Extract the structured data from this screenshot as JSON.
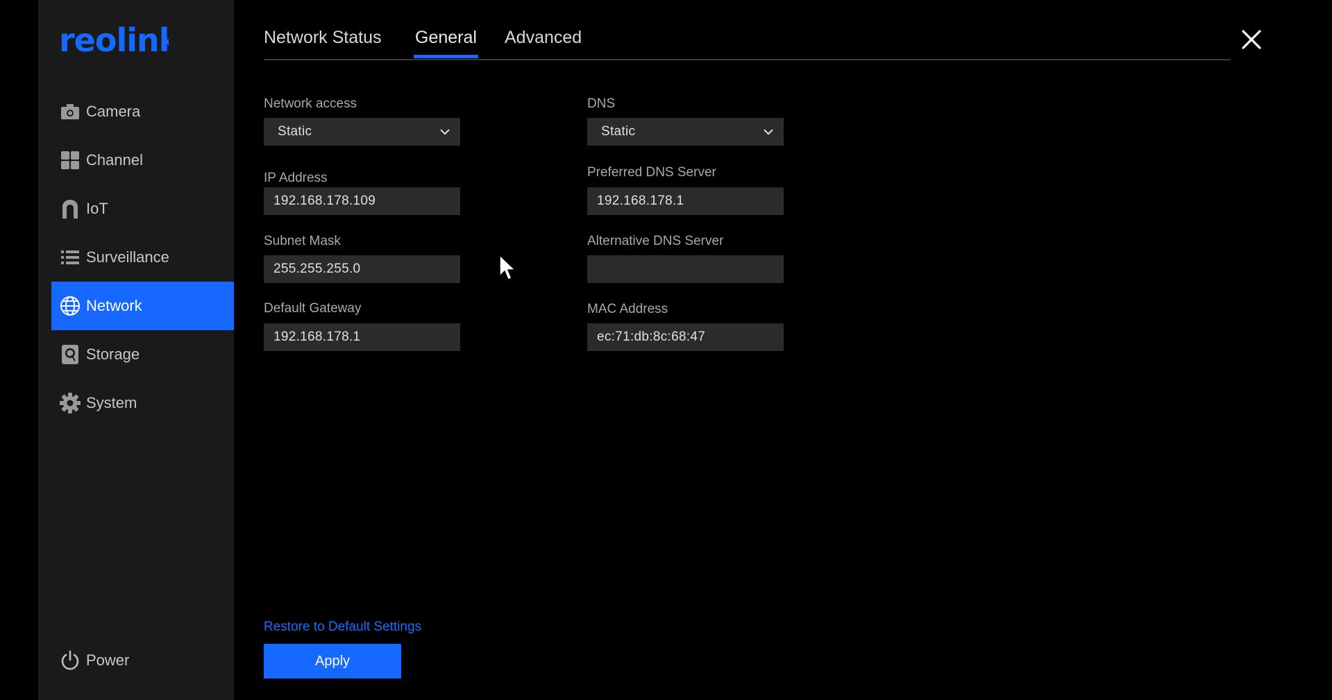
{
  "brand": {
    "name": "reolink",
    "color": "#1668ff"
  },
  "sidebar": {
    "items": [
      {
        "label": "Camera",
        "icon": "camera-icon"
      },
      {
        "label": "Channel",
        "icon": "grid-icon"
      },
      {
        "label": "IoT",
        "icon": "home-icon"
      },
      {
        "label": "Surveillance",
        "icon": "list-icon"
      },
      {
        "label": "Network",
        "icon": "globe-icon",
        "active": true
      },
      {
        "label": "Storage",
        "icon": "storage-icon"
      },
      {
        "label": "System",
        "icon": "gear-icon"
      }
    ],
    "power_label": "Power"
  },
  "tabs": [
    {
      "label": "Network Status"
    },
    {
      "label": "General",
      "active": true
    },
    {
      "label": "Advanced"
    }
  ],
  "form": {
    "network_access": {
      "label": "Network access",
      "value": "Static"
    },
    "ip_address": {
      "label": "IP Address",
      "value": "192.168.178.109"
    },
    "subnet_mask": {
      "label": "Subnet Mask",
      "value": "255.255.255.0"
    },
    "default_gateway": {
      "label": "Default Gateway",
      "value": "192.168.178.1"
    },
    "dns": {
      "label": "DNS",
      "value": "Static"
    },
    "preferred_dns": {
      "label": "Preferred DNS Server",
      "value": "192.168.178.1"
    },
    "alternative_dns": {
      "label": "Alternative DNS Server",
      "value": ""
    },
    "mac_address": {
      "label": "MAC Address",
      "value": "ec:71:db:8c:68:47"
    }
  },
  "actions": {
    "restore_label": "Restore to Default Settings",
    "apply_label": "Apply"
  }
}
